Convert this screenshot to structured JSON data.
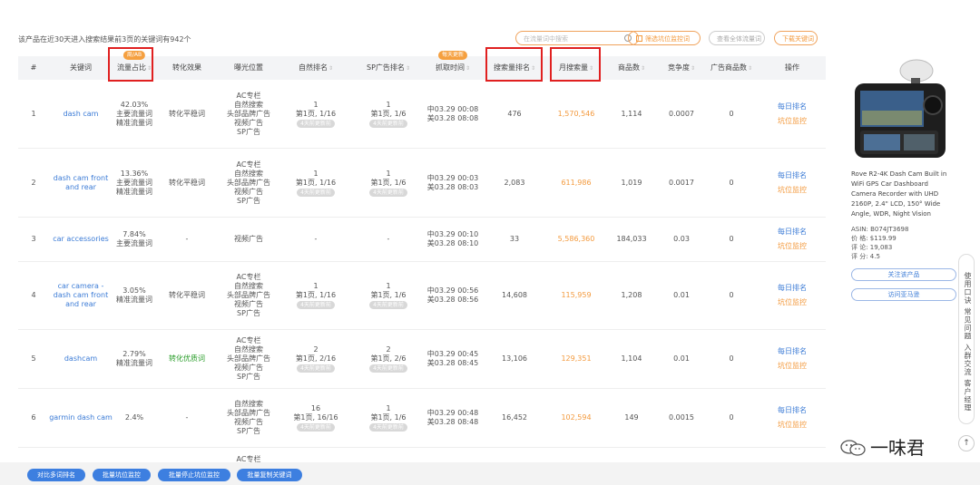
{
  "topbar": {
    "summary": "该产品在近30天进入搜索结果前3页的关键词有942个",
    "search_placeholder": "在流量词中搜索",
    "filter_label": "筛选坑位监控词",
    "stats_label": "查看全体流量词",
    "download_label": "下载关键词"
  },
  "table": {
    "headers": {
      "index": "#",
      "keyword": "关键词",
      "traffic_share": "流量占比",
      "traffic_share_tag": "周/AB",
      "conversion": "转化效果",
      "exposure": "曝光位置",
      "organic_rank": "自然排名",
      "sp_rank": "SP广告排名",
      "capture_time": "抓取时间",
      "capture_time_tag": "每天更新",
      "search_rank": "搜索量排名",
      "monthly_search": "月搜索量",
      "product_count": "商品数",
      "competition": "竞争度",
      "ad_product_count": "广告商品数",
      "actions": "操作"
    },
    "rows": [
      {
        "index": "1",
        "keyword": "dash cam",
        "share": "42.03%",
        "share_tags": [
          "主要流量词",
          "精准流量词"
        ],
        "conversion": "转化平稳词",
        "conversion_style": "normal",
        "exposure": [
          "AC专栏",
          "自然搜索",
          "头部品牌广告",
          "视频广告",
          "SP广告"
        ],
        "organic": [
          "1",
          "第1页, 1/16"
        ],
        "organic_badge": "4天前更新前",
        "sp": [
          "1",
          "第1页, 1/6"
        ],
        "sp_badge": "4天前更新前",
        "time_cn": "中03.29 00:08",
        "time_us": "美03.28 08:08",
        "search_rank": "476",
        "monthly_search": "1,570,546",
        "products": "1,114",
        "competition": "0.0007",
        "ad_products": "0",
        "action1": "每日排名",
        "action2": "坑位监控"
      },
      {
        "index": "2",
        "keyword": "dash cam front and rear",
        "share": "13.36%",
        "share_tags": [
          "主要流量词",
          "精准流量词"
        ],
        "conversion": "转化平稳词",
        "conversion_style": "normal",
        "exposure": [
          "AC专栏",
          "自然搜索",
          "头部品牌广告",
          "视频广告",
          "SP广告"
        ],
        "organic": [
          "1",
          "第1页, 1/16"
        ],
        "organic_badge": "4天前更新前",
        "sp": [
          "1",
          "第1页, 1/6"
        ],
        "sp_badge": "4天前更新前",
        "time_cn": "中03.29 00:03",
        "time_us": "美03.28 08:03",
        "search_rank": "2,083",
        "monthly_search": "611,986",
        "products": "1,019",
        "competition": "0.0017",
        "ad_products": "0",
        "action1": "每日排名",
        "action2": "坑位监控"
      },
      {
        "index": "3",
        "keyword": "car accessories",
        "share": "7.84%",
        "share_tags": [
          "主要流量词"
        ],
        "conversion": "-",
        "conversion_style": "normal",
        "exposure": [
          "视频广告"
        ],
        "organic": [
          "-"
        ],
        "organic_badge": "",
        "sp": [
          "-"
        ],
        "sp_badge": "",
        "time_cn": "中03.29 00:10",
        "time_us": "美03.28 08:10",
        "search_rank": "33",
        "monthly_search": "5,586,360",
        "products": "184,033",
        "competition": "0.03",
        "ad_products": "0",
        "action1": "每日排名",
        "action2": "坑位监控"
      },
      {
        "index": "4",
        "keyword": "car camera - dash cam front and rear",
        "share": "3.05%",
        "share_tags": [
          "精准流量词"
        ],
        "conversion": "转化平稳词",
        "conversion_style": "normal",
        "exposure": [
          "AC专栏",
          "自然搜索",
          "头部品牌广告",
          "视频广告",
          "SP广告"
        ],
        "organic": [
          "1",
          "第1页, 1/16"
        ],
        "organic_badge": "4天前更新前",
        "sp": [
          "1",
          "第1页, 1/6"
        ],
        "sp_badge": "4天前更新前",
        "time_cn": "中03.29 00:56",
        "time_us": "美03.28 08:56",
        "search_rank": "14,608",
        "monthly_search": "115,959",
        "products": "1,208",
        "competition": "0.01",
        "ad_products": "0",
        "action1": "每日排名",
        "action2": "坑位监控"
      },
      {
        "index": "5",
        "keyword": "dashcam",
        "share": "2.79%",
        "share_tags": [
          "精准流量词"
        ],
        "conversion": "转化优质词",
        "conversion_style": "green",
        "exposure": [
          "AC专栏",
          "自然搜索",
          "头部品牌广告",
          "视频广告",
          "SP广告"
        ],
        "organic": [
          "2",
          "第1页, 2/16"
        ],
        "organic_badge": "4天前更新前",
        "sp": [
          "2",
          "第1页, 2/6"
        ],
        "sp_badge": "4天前更新前",
        "time_cn": "中03.29 00:45",
        "time_us": "美03.28 08:45",
        "search_rank": "13,106",
        "monthly_search": "129,351",
        "products": "1,104",
        "competition": "0.01",
        "ad_products": "0",
        "action1": "每日排名",
        "action2": "坑位监控"
      },
      {
        "index": "6",
        "keyword": "garmin dash cam",
        "share": "2.4%",
        "share_tags": [],
        "conversion": "-",
        "conversion_style": "normal",
        "exposure": [
          "自然搜索",
          "头部品牌广告",
          "视频广告",
          "SP广告"
        ],
        "organic": [
          "16",
          "第1页, 16/16"
        ],
        "organic_badge": "4天前更新前",
        "sp": [
          "1",
          "第1页, 1/6"
        ],
        "sp_badge": "4天前更新前",
        "time_cn": "中03.29 00:48",
        "time_us": "美03.28 08:48",
        "search_rank": "16,452",
        "monthly_search": "102,594",
        "products": "149",
        "competition": "0.0015",
        "ad_products": "0",
        "action1": "每日排名",
        "action2": "坑位监控"
      }
    ],
    "partial_row_text": "AC专栏"
  },
  "product": {
    "title": "Rove R2-4K Dash Cam Built in WiFi GPS Car Dashboard Camera Recorder with UHD 2160P, 2.4\" LCD, 150° Wide Angle, WDR, Night Vision",
    "asin": "ASIN:  B074JT3698",
    "price": "价 格:  $119.99",
    "reviews": "评 论:  19,083",
    "rating": "评 分:  4.5",
    "follow_button": "关注该产品",
    "visit_button": "访问亚马逊"
  },
  "side": {
    "strip_text": "使用口诀 常见问题 入群交流 客户经理",
    "top_label": "↑"
  },
  "watermark": "一味君",
  "bottom": {
    "btn1": "对比多词排名",
    "btn2": "批量坑位监控",
    "btn3": "批量停止坑位监控",
    "btn4": "批量复制关键词"
  },
  "colors": {
    "accent_orange": "#f39a3e",
    "link_blue": "#3b7bd6",
    "highlight_red": "#e02020",
    "button_blue": "#3d7fe0"
  }
}
